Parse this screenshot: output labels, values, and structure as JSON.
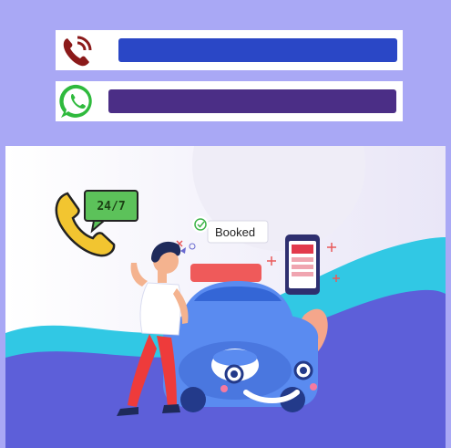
{
  "contact": {
    "call_bar": {
      "icon": "phone-ringing-icon",
      "accent": "#2a47c6"
    },
    "whatsapp_bar": {
      "icon": "whatsapp-icon",
      "accent": "#4b2e86"
    }
  },
  "illustration": {
    "badge_text": "24/7",
    "booked_label": "Booked",
    "colors": {
      "car": "#5a8bf0",
      "pants": "#ee3b3b",
      "wave": "#31c8e4",
      "ground": "#5d5fd9"
    }
  }
}
